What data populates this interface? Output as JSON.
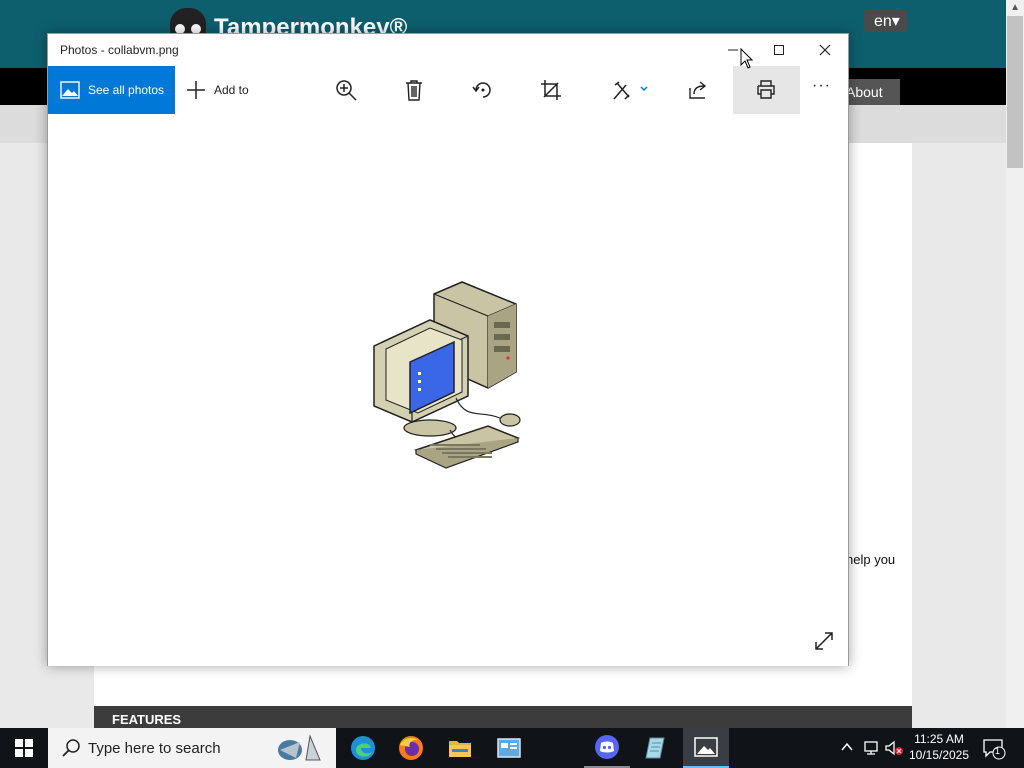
{
  "background_page": {
    "brand": "Tampermonkey®",
    "lang": "en▾",
    "nav_about": "About",
    "help_text": "help you",
    "features_heading": "FEATURES"
  },
  "window": {
    "title": "Photos - collabvm.png",
    "controls": {
      "minimize": "minimize-icon",
      "maximize": "maximize-icon",
      "close": "close-icon"
    }
  },
  "toolbar": {
    "see_all_label": "See all photos",
    "add_to_label": "Add to",
    "icons": [
      "zoom-in-icon",
      "delete-icon",
      "rotate-icon",
      "crop-icon",
      "edit-create-icon",
      "share-icon",
      "print-icon",
      "more-icon"
    ],
    "more_label": "···"
  },
  "image": {
    "subject": "computer-icon"
  },
  "taskbar": {
    "search_placeholder": "Type here to search",
    "apps": [
      "edge-icon",
      "firefox-icon",
      "file-explorer-icon",
      "control-panel-icon",
      "discord-icon",
      "notepad-icon",
      "photos-icon"
    ],
    "time": "11:25 AM",
    "date": "10/15/2025",
    "notification_count": "1"
  },
  "colors": {
    "accent": "#0078d7",
    "taskbar": "#101418",
    "site_header": "#0e5f6e"
  }
}
